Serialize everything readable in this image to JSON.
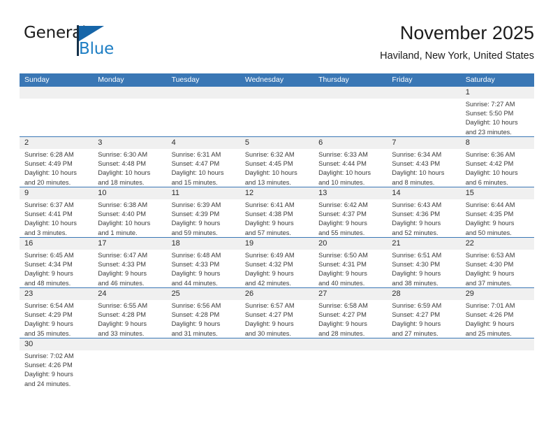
{
  "brand": {
    "name_top": "General",
    "name_bottom": "Blue",
    "accent_color": "#1d7ec4",
    "flag_color": "#1665a8"
  },
  "header": {
    "title": "November 2025",
    "subtitle": "Haviland, New York, United States"
  },
  "calendar": {
    "header_color": "#3a77b5",
    "daynum_band_color": "#f0f0f0",
    "weekdays": [
      "Sunday",
      "Monday",
      "Tuesday",
      "Wednesday",
      "Thursday",
      "Friday",
      "Saturday"
    ],
    "weeks": [
      [
        {
          "day": "",
          "l1": "",
          "l2": "",
          "l3": "",
          "l4": ""
        },
        {
          "day": "",
          "l1": "",
          "l2": "",
          "l3": "",
          "l4": ""
        },
        {
          "day": "",
          "l1": "",
          "l2": "",
          "l3": "",
          "l4": ""
        },
        {
          "day": "",
          "l1": "",
          "l2": "",
          "l3": "",
          "l4": ""
        },
        {
          "day": "",
          "l1": "",
          "l2": "",
          "l3": "",
          "l4": ""
        },
        {
          "day": "",
          "l1": "",
          "l2": "",
          "l3": "",
          "l4": ""
        },
        {
          "day": "1",
          "l1": "Sunrise: 7:27 AM",
          "l2": "Sunset: 5:50 PM",
          "l3": "Daylight: 10 hours",
          "l4": "and 23 minutes."
        }
      ],
      [
        {
          "day": "2",
          "l1": "Sunrise: 6:28 AM",
          "l2": "Sunset: 4:49 PM",
          "l3": "Daylight: 10 hours",
          "l4": "and 20 minutes."
        },
        {
          "day": "3",
          "l1": "Sunrise: 6:30 AM",
          "l2": "Sunset: 4:48 PM",
          "l3": "Daylight: 10 hours",
          "l4": "and 18 minutes."
        },
        {
          "day": "4",
          "l1": "Sunrise: 6:31 AM",
          "l2": "Sunset: 4:47 PM",
          "l3": "Daylight: 10 hours",
          "l4": "and 15 minutes."
        },
        {
          "day": "5",
          "l1": "Sunrise: 6:32 AM",
          "l2": "Sunset: 4:45 PM",
          "l3": "Daylight: 10 hours",
          "l4": "and 13 minutes."
        },
        {
          "day": "6",
          "l1": "Sunrise: 6:33 AM",
          "l2": "Sunset: 4:44 PM",
          "l3": "Daylight: 10 hours",
          "l4": "and 10 minutes."
        },
        {
          "day": "7",
          "l1": "Sunrise: 6:34 AM",
          "l2": "Sunset: 4:43 PM",
          "l3": "Daylight: 10 hours",
          "l4": "and 8 minutes."
        },
        {
          "day": "8",
          "l1": "Sunrise: 6:36 AM",
          "l2": "Sunset: 4:42 PM",
          "l3": "Daylight: 10 hours",
          "l4": "and 6 minutes."
        }
      ],
      [
        {
          "day": "9",
          "l1": "Sunrise: 6:37 AM",
          "l2": "Sunset: 4:41 PM",
          "l3": "Daylight: 10 hours",
          "l4": "and 3 minutes."
        },
        {
          "day": "10",
          "l1": "Sunrise: 6:38 AM",
          "l2": "Sunset: 4:40 PM",
          "l3": "Daylight: 10 hours",
          "l4": "and 1 minute."
        },
        {
          "day": "11",
          "l1": "Sunrise: 6:39 AM",
          "l2": "Sunset: 4:39 PM",
          "l3": "Daylight: 9 hours",
          "l4": "and 59 minutes."
        },
        {
          "day": "12",
          "l1": "Sunrise: 6:41 AM",
          "l2": "Sunset: 4:38 PM",
          "l3": "Daylight: 9 hours",
          "l4": "and 57 minutes."
        },
        {
          "day": "13",
          "l1": "Sunrise: 6:42 AM",
          "l2": "Sunset: 4:37 PM",
          "l3": "Daylight: 9 hours",
          "l4": "and 55 minutes."
        },
        {
          "day": "14",
          "l1": "Sunrise: 6:43 AM",
          "l2": "Sunset: 4:36 PM",
          "l3": "Daylight: 9 hours",
          "l4": "and 52 minutes."
        },
        {
          "day": "15",
          "l1": "Sunrise: 6:44 AM",
          "l2": "Sunset: 4:35 PM",
          "l3": "Daylight: 9 hours",
          "l4": "and 50 minutes."
        }
      ],
      [
        {
          "day": "16",
          "l1": "Sunrise: 6:45 AM",
          "l2": "Sunset: 4:34 PM",
          "l3": "Daylight: 9 hours",
          "l4": "and 48 minutes."
        },
        {
          "day": "17",
          "l1": "Sunrise: 6:47 AM",
          "l2": "Sunset: 4:33 PM",
          "l3": "Daylight: 9 hours",
          "l4": "and 46 minutes."
        },
        {
          "day": "18",
          "l1": "Sunrise: 6:48 AM",
          "l2": "Sunset: 4:33 PM",
          "l3": "Daylight: 9 hours",
          "l4": "and 44 minutes."
        },
        {
          "day": "19",
          "l1": "Sunrise: 6:49 AM",
          "l2": "Sunset: 4:32 PM",
          "l3": "Daylight: 9 hours",
          "l4": "and 42 minutes."
        },
        {
          "day": "20",
          "l1": "Sunrise: 6:50 AM",
          "l2": "Sunset: 4:31 PM",
          "l3": "Daylight: 9 hours",
          "l4": "and 40 minutes."
        },
        {
          "day": "21",
          "l1": "Sunrise: 6:51 AM",
          "l2": "Sunset: 4:30 PM",
          "l3": "Daylight: 9 hours",
          "l4": "and 38 minutes."
        },
        {
          "day": "22",
          "l1": "Sunrise: 6:53 AM",
          "l2": "Sunset: 4:30 PM",
          "l3": "Daylight: 9 hours",
          "l4": "and 37 minutes."
        }
      ],
      [
        {
          "day": "23",
          "l1": "Sunrise: 6:54 AM",
          "l2": "Sunset: 4:29 PM",
          "l3": "Daylight: 9 hours",
          "l4": "and 35 minutes."
        },
        {
          "day": "24",
          "l1": "Sunrise: 6:55 AM",
          "l2": "Sunset: 4:28 PM",
          "l3": "Daylight: 9 hours",
          "l4": "and 33 minutes."
        },
        {
          "day": "25",
          "l1": "Sunrise: 6:56 AM",
          "l2": "Sunset: 4:28 PM",
          "l3": "Daylight: 9 hours",
          "l4": "and 31 minutes."
        },
        {
          "day": "26",
          "l1": "Sunrise: 6:57 AM",
          "l2": "Sunset: 4:27 PM",
          "l3": "Daylight: 9 hours",
          "l4": "and 30 minutes."
        },
        {
          "day": "27",
          "l1": "Sunrise: 6:58 AM",
          "l2": "Sunset: 4:27 PM",
          "l3": "Daylight: 9 hours",
          "l4": "and 28 minutes."
        },
        {
          "day": "28",
          "l1": "Sunrise: 6:59 AM",
          "l2": "Sunset: 4:27 PM",
          "l3": "Daylight: 9 hours",
          "l4": "and 27 minutes."
        },
        {
          "day": "29",
          "l1": "Sunrise: 7:01 AM",
          "l2": "Sunset: 4:26 PM",
          "l3": "Daylight: 9 hours",
          "l4": "and 25 minutes."
        }
      ],
      [
        {
          "day": "30",
          "l1": "Sunrise: 7:02 AM",
          "l2": "Sunset: 4:26 PM",
          "l3": "Daylight: 9 hours",
          "l4": "and 24 minutes."
        },
        {
          "day": "",
          "l1": "",
          "l2": "",
          "l3": "",
          "l4": ""
        },
        {
          "day": "",
          "l1": "",
          "l2": "",
          "l3": "",
          "l4": ""
        },
        {
          "day": "",
          "l1": "",
          "l2": "",
          "l3": "",
          "l4": ""
        },
        {
          "day": "",
          "l1": "",
          "l2": "",
          "l3": "",
          "l4": ""
        },
        {
          "day": "",
          "l1": "",
          "l2": "",
          "l3": "",
          "l4": ""
        },
        {
          "day": "",
          "l1": "",
          "l2": "",
          "l3": "",
          "l4": ""
        }
      ]
    ]
  }
}
